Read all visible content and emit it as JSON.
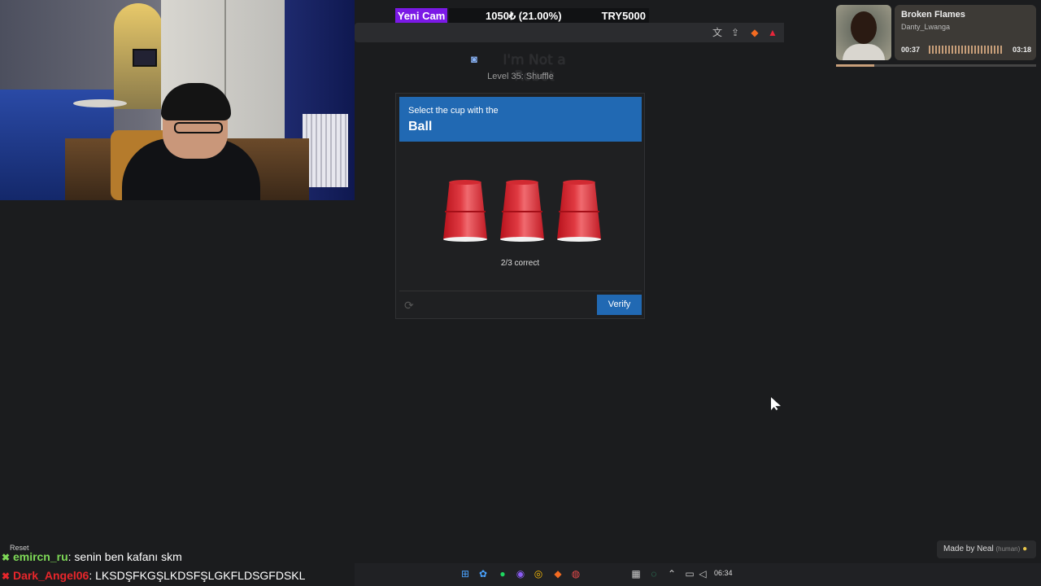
{
  "stream_banner": {
    "camera_label": "Yeni Cam",
    "balance": "1050₺ (21.00%)",
    "goal": "TRY5000"
  },
  "page": {
    "title": "I'm Not a Robot",
    "level": "Level 35: Shuffle"
  },
  "captcha": {
    "instruction": "Select the cup with the",
    "target": "Ball",
    "cups": [
      "cup-1",
      "cup-2",
      "cup-3"
    ],
    "status": "2/3 correct",
    "verify_label": "Verify"
  },
  "music": {
    "title": "Broken Flames",
    "artist": "Danty_Lwanga",
    "current_time": "00:37",
    "total_time": "03:18",
    "progress_fraction": 0.19
  },
  "made_by": {
    "label": "Made by Neal",
    "tag": "(human)"
  },
  "chat": {
    "reset_label": "Reset",
    "messages": [
      {
        "user": "emircn_ru",
        "text": ": senin ben kafanı skm",
        "color": "#7ed957"
      },
      {
        "user": "Dark_Angel06",
        "text": ": LKSDŞFKGŞLKDSFŞLGKFLDSGFDSKL",
        "color": "#e8262b"
      }
    ]
  },
  "taskbar": {
    "clock": "06:34"
  },
  "colors": {
    "accent_blue": "#2169b3",
    "cup_red": "#d22a32",
    "camera_purple": "#7b19e6"
  }
}
